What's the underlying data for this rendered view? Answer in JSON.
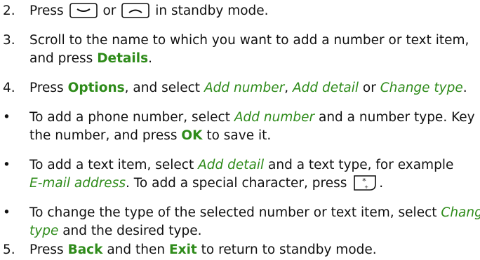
{
  "steps": {
    "s2": {
      "num": "2.",
      "t1": "Press",
      "t2": "or",
      "t3": "in standby mode."
    },
    "s3": {
      "num": "3.",
      "l1": "Scroll to the name to which you want to add a number or text item,",
      "l2a": "and press",
      "details": "Details",
      "l2b": "."
    },
    "s4": {
      "num": "4.",
      "t1": "Press",
      "options": "Options",
      "t2": ", and select",
      "add_number": "Add number",
      "c1": ",",
      "add_detail": "Add detail",
      "t3": "or",
      "change_type": "Change type",
      "t4": "."
    },
    "b1": {
      "bullet": "•",
      "l1a": "To add a phone number, select",
      "add_number": "Add number",
      "l1b": "and a number type. Key in",
      "l2a": "the number, and press",
      "ok": "OK",
      "l2b": "to save it."
    },
    "b2": {
      "bullet": "•",
      "l1a": "To add a text item, select",
      "add_detail": "Add detail",
      "l1b": "and a text type, for example",
      "email": "E-mail address",
      "l2a": ". To add a special character, press",
      "l2b": "."
    },
    "b3": {
      "bullet": "•",
      "l1a": "To change the type of the selected number or text item, select",
      "change": "Change",
      "type": "type",
      "l2b": "and the desired type."
    },
    "s5": {
      "num": "5.",
      "t1": "Press",
      "back": "Back",
      "t2": "and then",
      "exit": "Exit",
      "t3": "to return to standby mode."
    }
  },
  "icons": {
    "scroll_down": "scroll-down-key-icon",
    "scroll_up": "scroll-up-key-icon",
    "star": "star-key-icon"
  },
  "colors": {
    "highlight": "#2e8b1a",
    "text": "#111111"
  }
}
